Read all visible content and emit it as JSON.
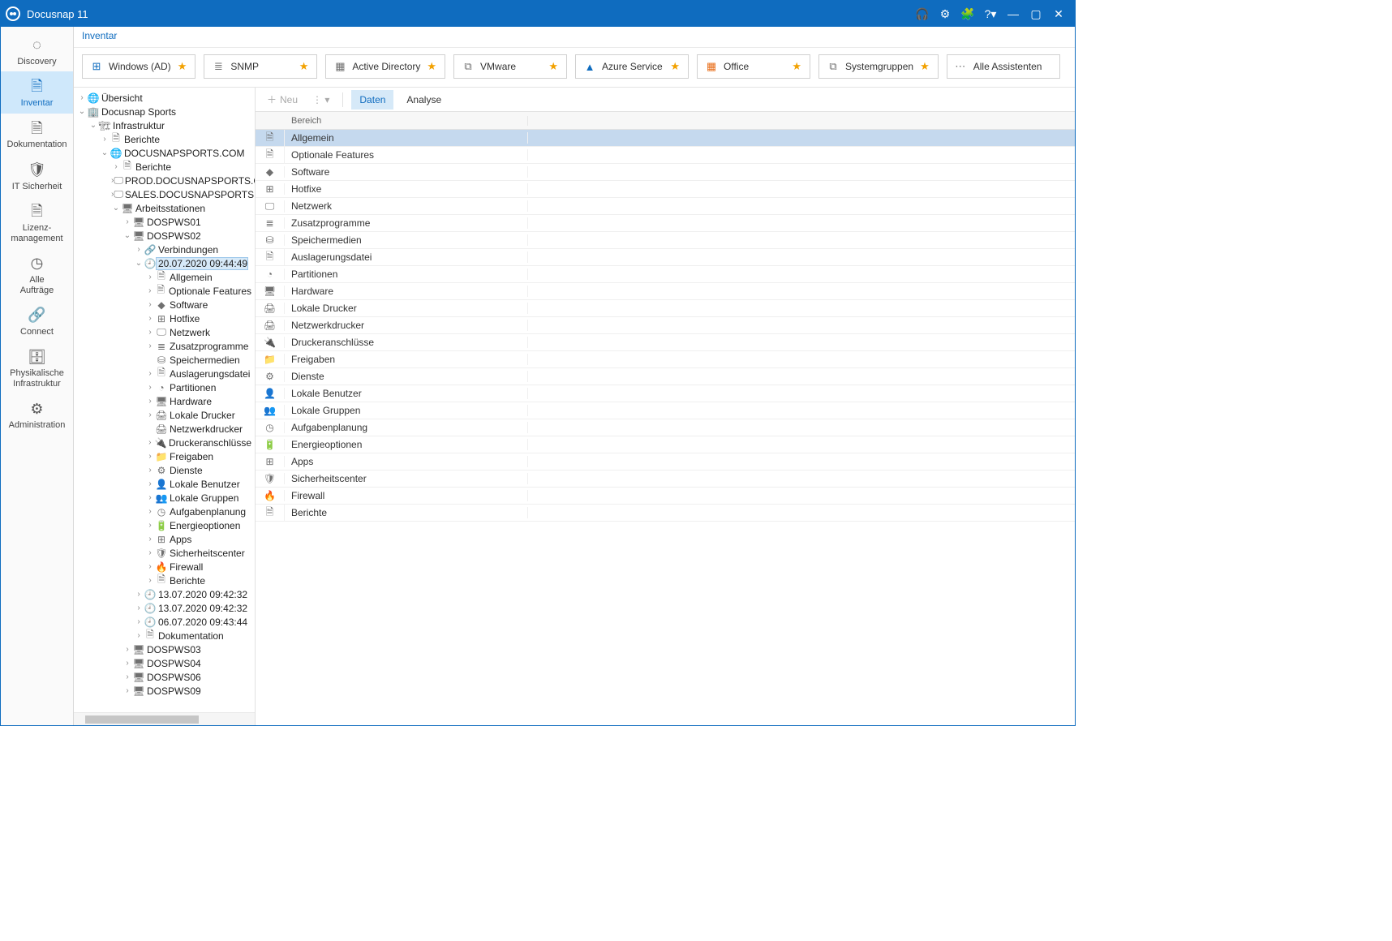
{
  "window": {
    "title": "Docusnap 11"
  },
  "titlebar_icons": [
    "headset",
    "gear",
    "options",
    "help",
    "minimize",
    "maximize",
    "close"
  ],
  "nav": [
    {
      "key": "discovery",
      "label": "Discovery",
      "icon": "◌"
    },
    {
      "key": "inventar",
      "label": "Inventar",
      "icon": "🗎",
      "active": true
    },
    {
      "key": "dokumentation",
      "label": "Dokumentation",
      "icon": "🗎"
    },
    {
      "key": "itsec",
      "label": "IT Sicherheit",
      "icon": "🛡"
    },
    {
      "key": "lizenz",
      "label": "Lizenz-\nmanagement",
      "icon": "🗎"
    },
    {
      "key": "auftraege",
      "label": "Alle\nAufträge",
      "icon": "◷"
    },
    {
      "key": "connect",
      "label": "Connect",
      "icon": "🔗"
    },
    {
      "key": "phys",
      "label": "Physikalische\nInfrastruktur",
      "icon": "🗄"
    },
    {
      "key": "admin",
      "label": "Administration",
      "icon": "⚙"
    }
  ],
  "breadcrumb": "Inventar",
  "cards": [
    {
      "key": "windows-ad",
      "icon": "⊞",
      "icon_color": "#0f6cbf",
      "label": "Windows (AD)",
      "star": true
    },
    {
      "key": "snmp",
      "icon": "≣",
      "icon_color": "#707070",
      "label": "SNMP",
      "star": true
    },
    {
      "key": "ad",
      "icon": "▦",
      "icon_color": "#707070",
      "label": "Active Directory",
      "star": true
    },
    {
      "key": "vmware",
      "icon": "⧉",
      "icon_color": "#707070",
      "label": "VMware",
      "star": true
    },
    {
      "key": "azure",
      "icon": "▲",
      "icon_color": "#0f6cbf",
      "label": "Azure Service",
      "star": true
    },
    {
      "key": "office",
      "icon": "▦",
      "icon_color": "#e86c17",
      "label": "Office",
      "star": true
    },
    {
      "key": "sysgrp",
      "icon": "⧉",
      "icon_color": "#707070",
      "label": "Systemgruppen",
      "star": true
    },
    {
      "key": "all",
      "icon": "⋯",
      "icon_color": "#707070",
      "label": "Alle Assistenten",
      "star": false,
      "all": true
    }
  ],
  "tree": [
    {
      "d": 0,
      "tw": ">",
      "ic": "🌐",
      "label": "Übersicht"
    },
    {
      "d": 0,
      "tw": "v",
      "ic": "🏢",
      "label": "Docusnap Sports"
    },
    {
      "d": 1,
      "tw": "v",
      "ic": "🏗",
      "label": "Infrastruktur"
    },
    {
      "d": 2,
      "tw": ">",
      "ic": "🗎",
      "label": "Berichte"
    },
    {
      "d": 2,
      "tw": "v",
      "ic": "🌐",
      "label": "DOCUSNAPSPORTS.COM"
    },
    {
      "d": 3,
      "tw": ">",
      "ic": "🗎",
      "label": "Berichte"
    },
    {
      "d": 3,
      "tw": ">",
      "ic": "🖵",
      "label": "PROD.DOCUSNAPSPORTS.CO"
    },
    {
      "d": 3,
      "tw": ">",
      "ic": "🖵",
      "label": "SALES.DOCUSNAPSPORTS.CO"
    },
    {
      "d": 3,
      "tw": "v",
      "ic": "🖥",
      "label": "Arbeitsstationen"
    },
    {
      "d": 4,
      "tw": ">",
      "ic": "🖥",
      "label": "DOSPWS01"
    },
    {
      "d": 4,
      "tw": "v",
      "ic": "🖥",
      "label": "DOSPWS02"
    },
    {
      "d": 5,
      "tw": ">",
      "ic": "🔗",
      "label": "Verbindungen"
    },
    {
      "d": 5,
      "tw": "v",
      "ic": "🕘",
      "label": "20.07.2020 09:44:49",
      "sel": true
    },
    {
      "d": 6,
      "tw": ">",
      "ic": "🗎",
      "label": "Allgemein"
    },
    {
      "d": 6,
      "tw": ">",
      "ic": "🗎",
      "label": "Optionale Features"
    },
    {
      "d": 6,
      "tw": ">",
      "ic": "◆",
      "label": "Software"
    },
    {
      "d": 6,
      "tw": ">",
      "ic": "⊞",
      "label": "Hotfixe"
    },
    {
      "d": 6,
      "tw": ">",
      "ic": "🖵",
      "label": "Netzwerk"
    },
    {
      "d": 6,
      "tw": ">",
      "ic": "≣",
      "label": "Zusatzprogramme"
    },
    {
      "d": 6,
      "tw": "",
      "ic": "⛁",
      "label": "Speichermedien"
    },
    {
      "d": 6,
      "tw": ">",
      "ic": "🗎",
      "label": "Auslagerungsdatei"
    },
    {
      "d": 6,
      "tw": ">",
      "ic": "◔",
      "label": "Partitionen"
    },
    {
      "d": 6,
      "tw": ">",
      "ic": "🖥",
      "label": "Hardware"
    },
    {
      "d": 6,
      "tw": ">",
      "ic": "🖨",
      "label": "Lokale Drucker"
    },
    {
      "d": 6,
      "tw": "",
      "ic": "🖨",
      "label": "Netzwerkdrucker"
    },
    {
      "d": 6,
      "tw": ">",
      "ic": "🔌",
      "label": "Druckeranschlüsse"
    },
    {
      "d": 6,
      "tw": ">",
      "ic": "📁",
      "label": "Freigaben"
    },
    {
      "d": 6,
      "tw": ">",
      "ic": "⚙",
      "label": "Dienste"
    },
    {
      "d": 6,
      "tw": ">",
      "ic": "👤",
      "label": "Lokale Benutzer"
    },
    {
      "d": 6,
      "tw": ">",
      "ic": "👥",
      "label": "Lokale Gruppen"
    },
    {
      "d": 6,
      "tw": ">",
      "ic": "◷",
      "label": "Aufgabenplanung"
    },
    {
      "d": 6,
      "tw": ">",
      "ic": "🔋",
      "label": "Energieoptionen"
    },
    {
      "d": 6,
      "tw": ">",
      "ic": "⊞",
      "label": "Apps"
    },
    {
      "d": 6,
      "tw": ">",
      "ic": "🛡",
      "label": "Sicherheitscenter"
    },
    {
      "d": 6,
      "tw": ">",
      "ic": "🔥",
      "label": "Firewall"
    },
    {
      "d": 6,
      "tw": ">",
      "ic": "🗎",
      "label": "Berichte"
    },
    {
      "d": 5,
      "tw": ">",
      "ic": "🕘",
      "label": "13.07.2020 09:42:32"
    },
    {
      "d": 5,
      "tw": ">",
      "ic": "🕘",
      "label": "13.07.2020 09:42:32"
    },
    {
      "d": 5,
      "tw": ">",
      "ic": "🕘",
      "label": "06.07.2020 09:43:44"
    },
    {
      "d": 5,
      "tw": ">",
      "ic": "🗎",
      "label": "Dokumentation"
    },
    {
      "d": 4,
      "tw": ">",
      "ic": "🖥",
      "label": "DOSPWS03"
    },
    {
      "d": 4,
      "tw": ">",
      "ic": "🖥",
      "label": "DOSPWS04"
    },
    {
      "d": 4,
      "tw": ">",
      "ic": "🖥",
      "label": "DOSPWS06"
    },
    {
      "d": 4,
      "tw": ">",
      "ic": "🖥",
      "label": "DOSPWS09"
    }
  ],
  "right": {
    "new_label": "Neu",
    "tabs": {
      "daten": "Daten",
      "analyse": "Analyse",
      "active": "daten"
    },
    "header": "Bereich",
    "rows": [
      {
        "ic": "🗎",
        "label": "Allgemein",
        "sel": true
      },
      {
        "ic": "🗎",
        "label": "Optionale Features"
      },
      {
        "ic": "◆",
        "label": "Software"
      },
      {
        "ic": "⊞",
        "label": "Hotfixe"
      },
      {
        "ic": "🖵",
        "label": "Netzwerk"
      },
      {
        "ic": "≣",
        "label": "Zusatzprogramme"
      },
      {
        "ic": "⛁",
        "label": "Speichermedien"
      },
      {
        "ic": "🗎",
        "label": "Auslagerungsdatei"
      },
      {
        "ic": "◔",
        "label": "Partitionen"
      },
      {
        "ic": "🖥",
        "label": "Hardware"
      },
      {
        "ic": "🖨",
        "label": "Lokale Drucker"
      },
      {
        "ic": "🖨",
        "label": "Netzwerkdrucker"
      },
      {
        "ic": "🔌",
        "label": "Druckeranschlüsse"
      },
      {
        "ic": "📁",
        "label": "Freigaben"
      },
      {
        "ic": "⚙",
        "label": "Dienste"
      },
      {
        "ic": "👤",
        "label": "Lokale Benutzer"
      },
      {
        "ic": "👥",
        "label": "Lokale Gruppen"
      },
      {
        "ic": "◷",
        "label": "Aufgabenplanung"
      },
      {
        "ic": "🔋",
        "label": "Energieoptionen"
      },
      {
        "ic": "⊞",
        "label": "Apps"
      },
      {
        "ic": "🛡",
        "label": "Sicherheitscenter"
      },
      {
        "ic": "🔥",
        "label": "Firewall"
      },
      {
        "ic": "🗎",
        "label": "Berichte"
      }
    ]
  }
}
